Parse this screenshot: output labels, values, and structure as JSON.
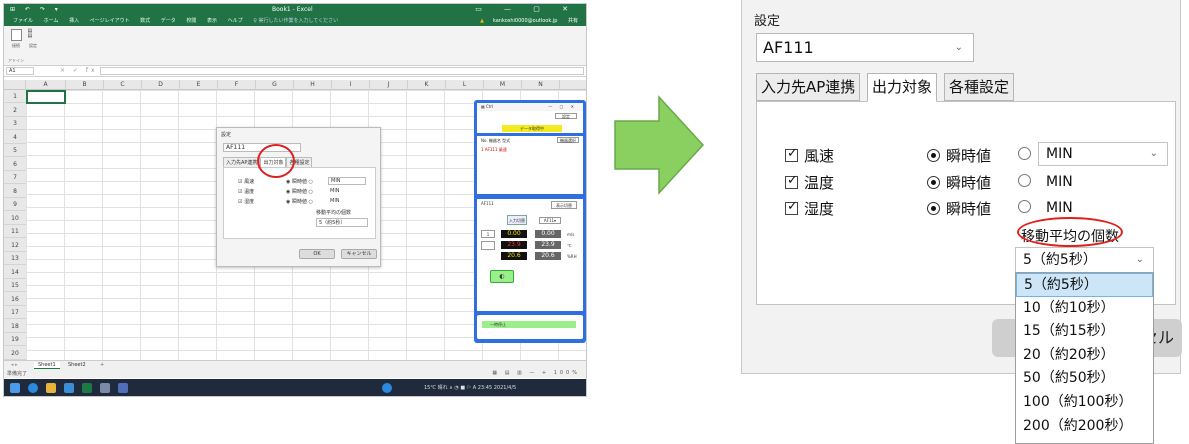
{
  "excel": {
    "window_title": "Book1 - Excel",
    "qat_glyphs": "⊞ ↶ ↷ ▾",
    "window_glyphs": "▭ — ▢ ✕",
    "ribbon_tabs": [
      "ファイル",
      "ホーム",
      "挿入",
      "ページレイアウト",
      "数式",
      "データ",
      "校閲",
      "表示",
      "ヘルプ"
    ],
    "tell_me": "♀ 実行したい作業を入力してください",
    "user_account": "kankoshi0000@outlook.jp",
    "user_initials": "共有",
    "ribbon_buttons": [
      {
        "label": "接続"
      },
      {
        "label": "設定"
      }
    ],
    "ribbon_group": "アドイン",
    "name_box": "A1",
    "formula_icons": "× ✓ fx",
    "columns": [
      "A",
      "B",
      "C",
      "D",
      "E",
      "F",
      "G",
      "H",
      "I",
      "J",
      "K",
      "L",
      "M",
      "N"
    ],
    "rows": [
      "1",
      "2",
      "3",
      "4",
      "5",
      "6",
      "7",
      "8",
      "9",
      "10",
      "11",
      "12",
      "13",
      "14",
      "15",
      "16",
      "17",
      "18",
      "19",
      "20"
    ],
    "sheet_tabs": [
      "Sheet1",
      "Sheet2",
      "+"
    ],
    "status_left": "準備完了",
    "status_right": "▦ ▤ ▥ — + 100%",
    "taskbar_text": "15℃ 晴れ  ∧ ◔ ■ ⚐  A  23:45 2021/4/5",
    "mini_dialog": {
      "title": "設定",
      "device": "AF111",
      "tabs": [
        "入力先AP連携",
        "出力対象",
        "各種設定"
      ],
      "rows": [
        {
          "label": "☑ 風速",
          "mode": "◉ 瞬時値 ○",
          "value": "MIN"
        },
        {
          "label": "☑ 温度",
          "mode": "◉ 瞬時値 ○",
          "value": "MIN"
        },
        {
          "label": "☑ 湿度",
          "mode": "◉ 瞬時値 ○",
          "value": "MIN"
        }
      ],
      "ma_label": "移動平均の個数",
      "ma_value": "5（約5秒）",
      "ok": "OK",
      "cancel": "キャンセル"
    },
    "side_panel": {
      "title": "▦ Ctrl",
      "window_glyphs": "—  ▢  ✕",
      "top_button": "設定",
      "status": "データ取得中",
      "list_header": "No. 機器名 型式",
      "list_button": "機器選択",
      "list_item": "1 AF111 風速",
      "device_name": "AF111",
      "device_button": "表示切替",
      "mode_button": "入力切替",
      "unit_button": "AF11▾",
      "readings": [
        {
          "left": "0.00",
          "right": "0.00",
          "unit": "m/s"
        },
        {
          "left": "23.9",
          "right": "23.9",
          "unit": "℃"
        },
        {
          "left": "20.6",
          "right": "20.6",
          "unit": "%RH"
        }
      ],
      "green_button": "◐",
      "bottom_bar": "一時停止"
    }
  },
  "dialog": {
    "title": "設定",
    "device_select": "AF111",
    "tabs": [
      {
        "label": "入力先AP連携",
        "active": false
      },
      {
        "label": "出力対象",
        "active": true
      },
      {
        "label": "各種設定",
        "active": false
      }
    ],
    "items": [
      {
        "label": "風速",
        "checked": true,
        "instant": "瞬時値",
        "value": "MIN",
        "value_is_dropdown": true
      },
      {
        "label": "温度",
        "checked": true,
        "instant": "瞬時値",
        "value": "MIN",
        "value_is_dropdown": false
      },
      {
        "label": "湿度",
        "checked": true,
        "instant": "瞬時値",
        "value": "MIN",
        "value_is_dropdown": false
      }
    ],
    "moving_average_label": "移動平均の個数",
    "moving_average_value": "5（約5秒）",
    "cancel_button_fragment": "セル",
    "dropdown_options": [
      {
        "label": "5（約5秒）",
        "highlighted": true
      },
      {
        "label": "10（約10秒）",
        "highlighted": false
      },
      {
        "label": "15（約15秒）",
        "highlighted": false
      },
      {
        "label": "20（約20秒）",
        "highlighted": false
      },
      {
        "label": "50（約50秒）",
        "highlighted": false
      },
      {
        "label": "100（約100秒）",
        "highlighted": false
      },
      {
        "label": "200（約200秒）",
        "highlighted": false
      }
    ]
  },
  "colors": {
    "excel_green": "#217346",
    "arrow_green": "#8ad060",
    "annotation_red": "#e0201e",
    "highlight_blue": "#cce6f7",
    "panel_blue": "#2f6fe0",
    "display_yellow": "#f5ea00"
  }
}
